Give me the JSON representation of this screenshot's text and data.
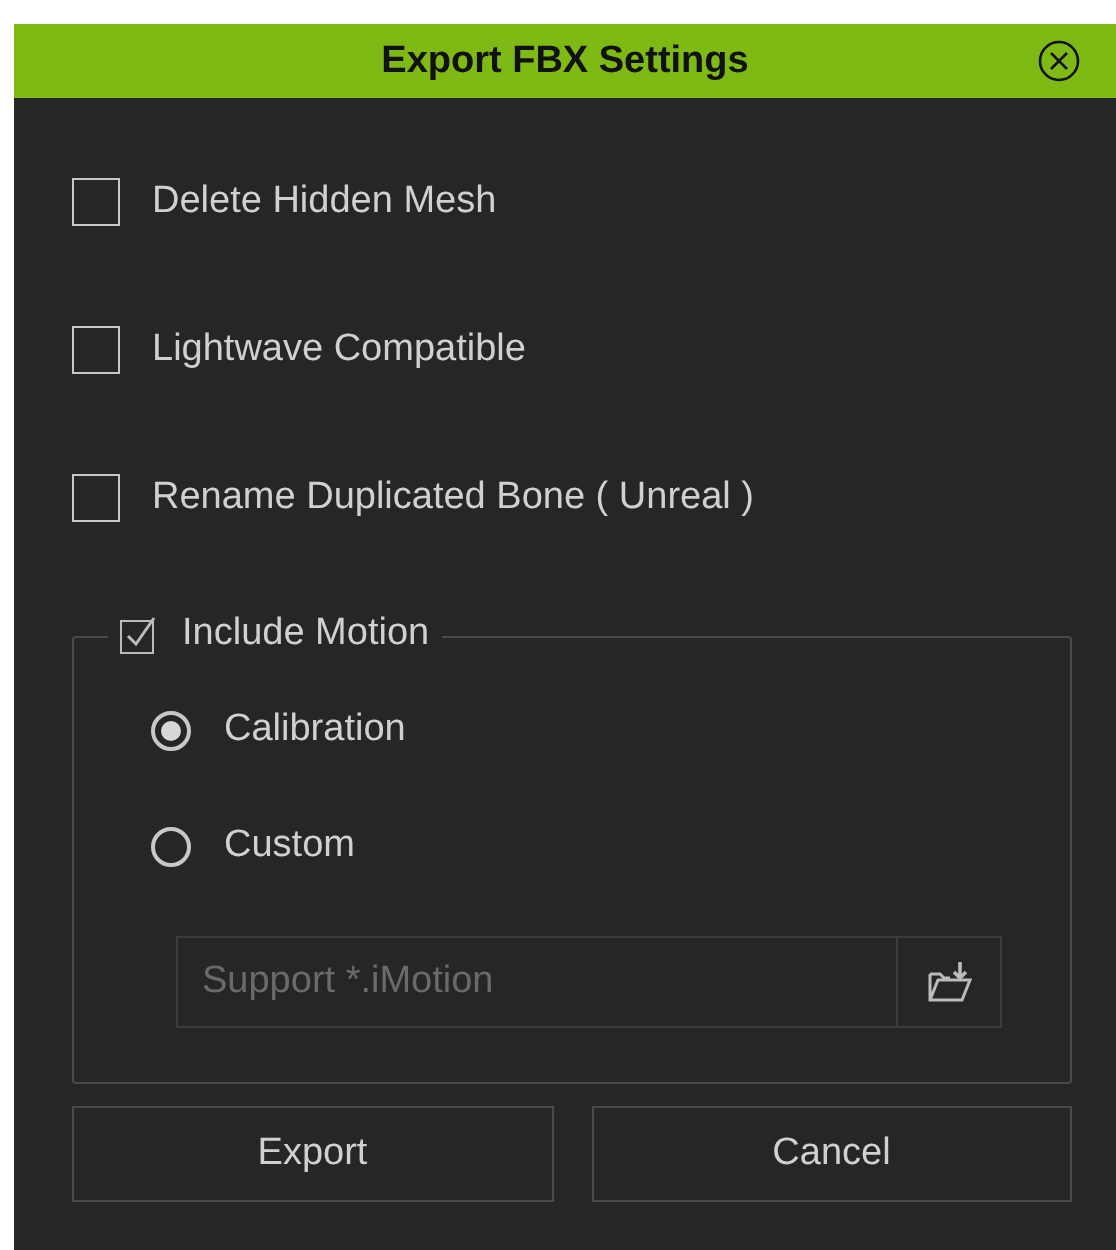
{
  "window": {
    "title": "Export FBX Settings"
  },
  "options": [
    {
      "label": "Delete Hidden Mesh",
      "checked": false
    },
    {
      "label": "Lightwave Compatible",
      "checked": false
    },
    {
      "label": "Rename Duplicated Bone ( Unreal )",
      "checked": false
    }
  ],
  "motion_group": {
    "label": "Include Motion",
    "checked": true,
    "radios": [
      {
        "label": "Calibration",
        "selected": true
      },
      {
        "label": "Custom",
        "selected": false
      }
    ],
    "file_field": {
      "placeholder": "Support *.iMotion"
    }
  },
  "buttons": [
    "Export",
    "Cancel"
  ]
}
